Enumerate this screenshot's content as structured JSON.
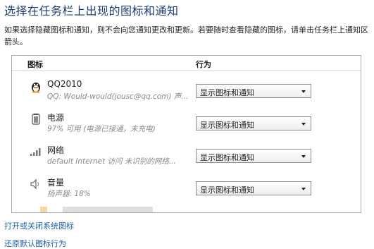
{
  "page_title": "选择在任务栏上出现的图标和通知",
  "description": {
    "line1": "如果选择隐藏图标和通知，则不会向您通知更改和更新。若要随时查看隐藏的图标，请单击任务栏上通知区",
    "line2": "箭头。"
  },
  "table": {
    "header_icon": "图标",
    "header_behavior": "行为",
    "rows": [
      {
        "icon": "qq-penguin-icon",
        "name": "QQ2010",
        "status": "QQ: Would-would(jousc@qq.com)  声...",
        "behavior": "显示图标和通知"
      },
      {
        "icon": "battery-icon",
        "name": "电源",
        "status": "97% 可用 (电源已接通，未充电)",
        "behavior": "显示图标和通知"
      },
      {
        "icon": "network-bars-icon",
        "name": "网络",
        "status": "default Internet 访问 未识别的网络...",
        "behavior": "显示图标和通知"
      },
      {
        "icon": "speaker-icon",
        "name": "音量",
        "status": "扬声器: 18%",
        "behavior": "显示图标和通知"
      }
    ]
  },
  "links": {
    "system_icons": "打开或关闭系统图标",
    "restore_defaults": "还原默认图标行为"
  },
  "colors": {
    "title": "#1e3d78",
    "link": "#1b5fb0",
    "status_text": "#8a8a8a"
  }
}
